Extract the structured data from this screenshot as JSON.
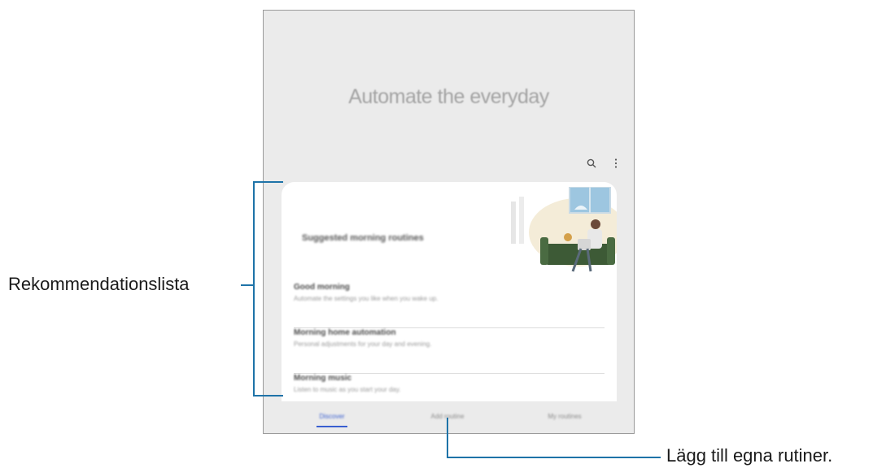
{
  "screen": {
    "headline": "Automate the everyday",
    "card": {
      "title": "Suggested morning routines",
      "items": [
        {
          "title": "Good morning",
          "subtitle": "Automate the settings you like when you wake up."
        },
        {
          "title": "Morning home automation",
          "subtitle": "Personal adjustments for your day and evening."
        },
        {
          "title": "Morning music",
          "subtitle": "Listen to music as you start your day."
        }
      ]
    },
    "tabs": [
      {
        "label": "Discover",
        "active": true
      },
      {
        "label": "Add routine",
        "active": false
      },
      {
        "label": "My routines",
        "active": false
      }
    ],
    "icons": {
      "search": "search-icon",
      "more": "more-vert-icon"
    }
  },
  "callouts": {
    "list": "Rekommendationslista",
    "add": "Lägg till egna rutiner."
  },
  "colors": {
    "accent": "#1e73a8",
    "tab_active": "#3a5fd0",
    "sofa": "#3d5a36"
  }
}
